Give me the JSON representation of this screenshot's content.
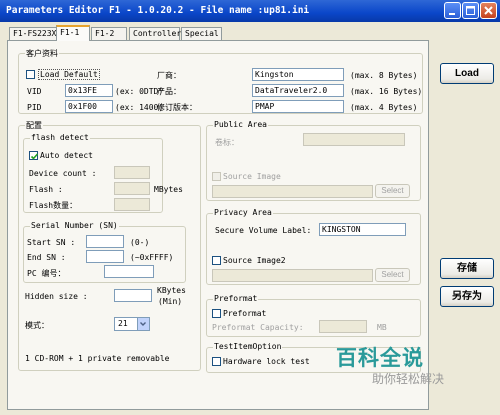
{
  "window": {
    "title": "Parameters Editor F1 - 1.0.20.2 - File name :up81.ini"
  },
  "tabs": [
    {
      "label": "F1-FS223X"
    },
    {
      "label": "F1-1"
    },
    {
      "label": "F1-2"
    },
    {
      "label": "Controller"
    },
    {
      "label": "Special"
    }
  ],
  "customer_info": {
    "title": "客户资料",
    "load_default": "Load Default",
    "vid_label": "VID",
    "vid_value": "0x13FE",
    "vid_hint": "(ex: 0DTD)",
    "pid_label": "PID",
    "pid_value": "0x1F00",
    "pid_hint": "(ex: 1400)",
    "vendor_label": "厂商：",
    "vendor_value": "Kingston",
    "vendor_hint": "(max. 8 Bytes)",
    "product_label": "产品：",
    "product_value": "DataTraveler2.0",
    "product_hint": "(max. 16 Bytes)",
    "revision_label": "修订版本：",
    "revision_value": "PMAP",
    "revision_hint": "(max. 4 Bytes)"
  },
  "config": {
    "title": "配置",
    "flash_detect": {
      "title": "flash detect",
      "auto_detect": "Auto detect",
      "auto_detect_checked": true,
      "device_count": "Device count :",
      "flash": "Flash :",
      "flash_unit": "MBytes",
      "flash_count": "Flash数量："
    },
    "serial": {
      "title": "Serial Number (SN)",
      "start_sn": "Start SN :",
      "start_hint": "(0-)",
      "end_sn": "End SN :",
      "end_hint": "(~0xFFFF)",
      "pc_number": "PC 编号："
    },
    "hidden_size": "Hidden size :",
    "hidden_unit": "KBytes",
    "hidden_min": "(Min)",
    "mode_label": "模式：",
    "mode_value": "21",
    "mode_desc": "1 CD-ROM + 1 private removable"
  },
  "public_area": {
    "title": "Public Area",
    "volume_label": "卷标：",
    "source_image": "Source Image",
    "select": "Select"
  },
  "privacy_area": {
    "title": "Privacy Area",
    "secure_label": "Secure Volume Label:",
    "secure_value": "KINGSTON",
    "source_image2": "Source Image2",
    "select": "Select"
  },
  "preformat": {
    "title": "Preformat",
    "preformat": "Preformat",
    "capacity": "Preformat Capacity:",
    "unit": "MB"
  },
  "test_option": {
    "title": "TestItemOption",
    "hardware_lock": "Hardware lock test"
  },
  "buttons": {
    "load": "Load",
    "save": "存储",
    "save_as": "另存为"
  },
  "watermark": {
    "logo": "百科全说",
    "sub": "助你轻松解决"
  }
}
